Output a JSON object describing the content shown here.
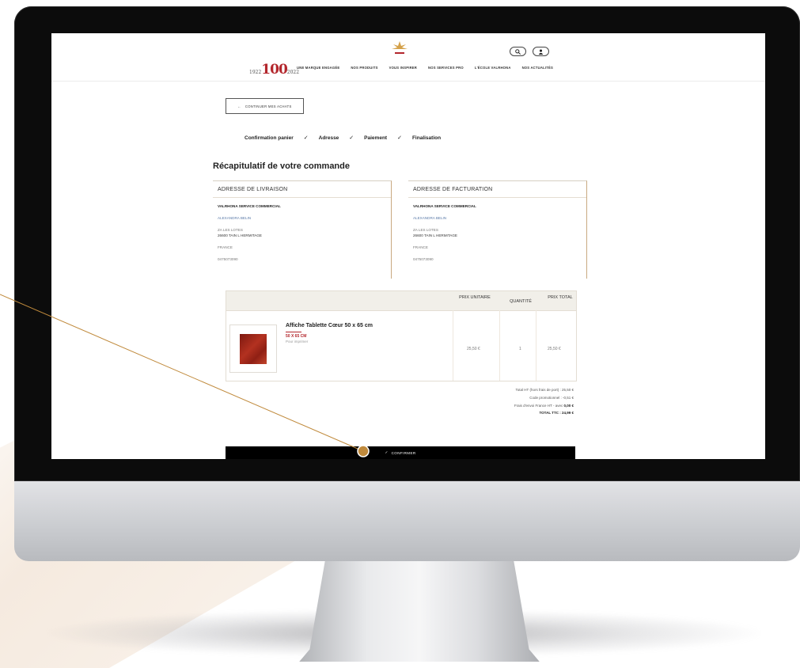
{
  "header": {
    "logo_number": "100",
    "nav": [
      "UNE MARQUE ENGAGÉE",
      "NOS PRODUITS",
      "VOUS INSPIRER",
      "NOS SERVICES PRO",
      "L'ÉCOLE VALRHONA",
      "NOS ACTUALITÉS"
    ],
    "search_icon": "search-icon",
    "account_icon": "user-icon"
  },
  "back_button": {
    "label": "CONTINUER MES ACHATS"
  },
  "steps": [
    {
      "label": "Confirmation panier",
      "done": true
    },
    {
      "label": "Adresse",
      "done": true
    },
    {
      "label": "Paiement",
      "done": true
    },
    {
      "label": "Finalisation",
      "done": false
    }
  ],
  "recap_title": "Récapitulatif de votre commande",
  "shipping": {
    "title": "ADRESSE DE LIVRAISON",
    "company": "VALRHONA SERVICE COMMERCIAL",
    "name": "ALEXANDRA BELIN",
    "street": "ZA LES LOTES",
    "city": "26600 TAIN L HERMITAGE",
    "country": "FRANCE",
    "phone": "0475073090"
  },
  "billing": {
    "title": "ADRESSE DE FACTURATION",
    "company": "VALRHONA SERVICE COMMERCIAL",
    "name": "ALEXANDRA BELIN",
    "street": "ZA LES LOTES",
    "city": "26600 TAIN L HERMITAGE",
    "country": "FRANCE",
    "phone": "0475073090"
  },
  "table": {
    "col_unit": "PRIX UNITAIRE",
    "col_qty": "QUANTITÉ",
    "col_total": "PRIX TOTAL",
    "product": {
      "name": "Affiche Tablette Cœur 50 x 65 cm",
      "size": "50 X 65 CM",
      "option": "Pour imprimer",
      "unit_price": "25,50 €",
      "quantity": "1",
      "total": "25,50 €"
    }
  },
  "totals": {
    "subtotal": "Total HT (hors frais de port) : 25,50 €",
    "promo": "Code promotionnel : -0,51 €",
    "shipping_label": "Frais d'envoi France HT - avec",
    "shipping_value": "0,00 €",
    "total": "TOTAL TTC : 24,99 €"
  },
  "confirm_button": {
    "label": "CONFIRMER"
  }
}
